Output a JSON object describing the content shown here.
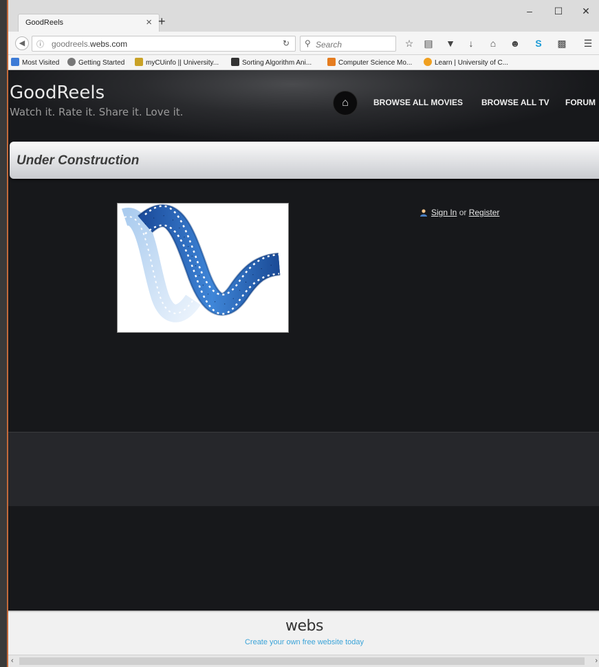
{
  "browser": {
    "tab_title": "GoodReels",
    "tab_close": "×",
    "new_tab": "+",
    "url_dim": "goodreels.",
    "url_main": "webs.com",
    "search_placeholder": "Search",
    "bookmarks": [
      {
        "label": "Most Visited",
        "color": "#3d7bd6"
      },
      {
        "label": "Getting Started",
        "color": "#777777"
      },
      {
        "label": "myCUinfo || University...",
        "color": "#c9a227"
      },
      {
        "label": "Sorting Algorithm Ani...",
        "color": "#333333"
      },
      {
        "label": "Computer Science Mo...",
        "color": "#e57c1f"
      },
      {
        "label": "Learn | University of C...",
        "color": "#f0a020"
      }
    ]
  },
  "site": {
    "title": "GoodReels",
    "tagline": "Watch it. Rate it. Share it. Love it.",
    "nav": [
      "BROWSE ALL MOVIES",
      "BROWSE ALL TV",
      "FORUM"
    ],
    "banner": "Under Construction",
    "signin": "Sign In",
    "or": " or ",
    "register": "Register"
  },
  "footer": {
    "logo": "webs",
    "tagline": "Create your own free website today"
  }
}
